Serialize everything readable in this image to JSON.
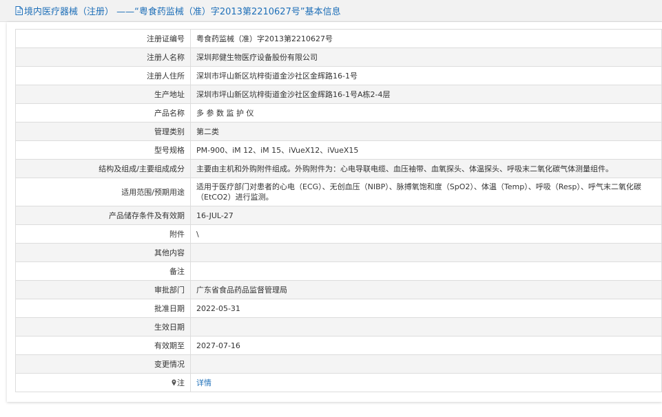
{
  "header": {
    "icon": "document-icon",
    "title": "境内医疗器械（注册） ——“粤食药监械（准）字2013第2210627号”基本信息"
  },
  "rows": [
    {
      "label": "注册证编号",
      "value": "粤食药监械（准）字2013第2210627号"
    },
    {
      "label": "注册人名称",
      "value": "深圳邦健生物医疗设备股份有限公司"
    },
    {
      "label": "注册人住所",
      "value": "深圳市坪山新区坑梓街道金沙社区金辉路16-1号"
    },
    {
      "label": "生产地址",
      "value": "深圳市坪山新区坑梓街道金沙社区金辉路16-1号A栋2-4层"
    },
    {
      "label": "产品名称",
      "value": "多 参 数 监 护 仪"
    },
    {
      "label": "管理类别",
      "value": "第二类"
    },
    {
      "label": "型号规格",
      "value": "PM-900、iM 12、iM 15、iVueX12、iVueX15"
    },
    {
      "label": "结构及组成/主要组成成分",
      "value": "主要由主机和外购附件组成。外购附件为：心电导联电缆、血压袖带、血氧探头、体温探头、呼吸末二氧化碳气体测量组件。"
    },
    {
      "label": "适用范围/预期用途",
      "value": "适用于医疗部门对患者的心电（ECG）、无创血压（NIBP）、脉搏氧饱和度（SpO2）、体温（Temp）、呼吸（Resp）、呼气末二氧化碳（EtCO2）进行监测。"
    },
    {
      "label": "产品储存条件及有效期",
      "value": "16-JUL-27"
    },
    {
      "label": "附件",
      "value": "\\"
    },
    {
      "label": "其他内容",
      "value": ""
    },
    {
      "label": "备注",
      "value": ""
    },
    {
      "label": "审批部门",
      "value": "广东省食品药品监督管理局"
    },
    {
      "label": "批准日期",
      "value": "2022-05-31"
    },
    {
      "label": "生效日期",
      "value": ""
    },
    {
      "label": "有效期至",
      "value": "2027-07-16"
    },
    {
      "label": "变更情况",
      "value": ""
    }
  ],
  "note": {
    "icon": "map-pin-icon",
    "label": "注",
    "link_text": "详情"
  }
}
